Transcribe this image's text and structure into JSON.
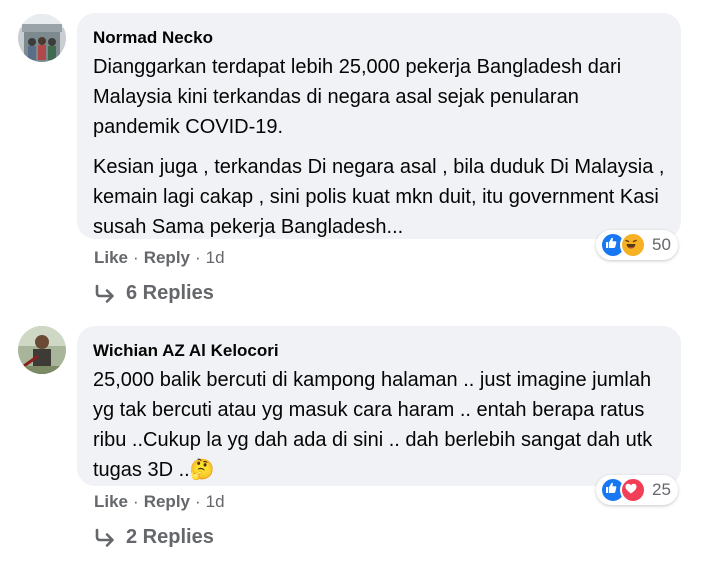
{
  "comments": [
    {
      "author": "Normad Necko",
      "paragraphs": [
        "Dianggarkan terdapat lebih 25,000 pekerja Bangladesh dari Malaysia kini terkandas di negara asal sejak penularan pandemik COVID-19.",
        "Kesian juga , terkandas Di negara asal , bila duduk Di Malaysia , kemain lagi cakap , sini polis kuat mkn duit, itu government Kasi susah Sama pekerja Bangladesh..."
      ],
      "reactions": {
        "icons": [
          "like-icon",
          "haha-icon"
        ],
        "count": "50"
      },
      "actions": {
        "like": "Like",
        "reply": "Reply",
        "time": "1d"
      },
      "replies_label": "6 Replies"
    },
    {
      "author": "Wichian AZ Al Kelocori",
      "paragraphs": [
        "25,000 balik bercuti di kampong halaman .. just imagine jumlah yg tak bercuti atau yg masuk cara haram .. entah berapa ratus ribu ..Cukup la yg dah ada di sini .. dah berlebih sangat dah utk tugas 3D ..🤔"
      ],
      "reactions": {
        "icons": [
          "like-icon",
          "love-icon"
        ],
        "count": "25"
      },
      "actions": {
        "like": "Like",
        "reply": "Reply",
        "time": "1d"
      },
      "replies_label": "2 Replies"
    }
  ],
  "colors": {
    "bubble": "#f0f2f5",
    "secondary_text": "#65676b",
    "like_blue": "#1877f2",
    "love_red": "#f33e58",
    "haha_yellow": "#f7b125"
  }
}
